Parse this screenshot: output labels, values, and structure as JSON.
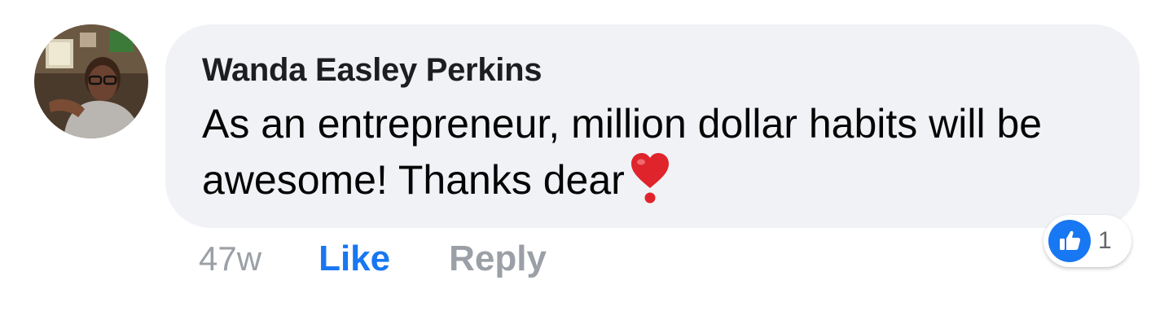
{
  "comment": {
    "author": "Wanda Easley Perkins",
    "text": "As an entrepreneur, million dollar habits will be awesome! Thanks dear",
    "emoji": "heavy-heart-exclamation",
    "timestamp": "47w",
    "like_label": "Like",
    "reply_label": "Reply",
    "reaction_count": "1",
    "reaction_type": "like-icon"
  },
  "colors": {
    "bubble_bg": "#f0f2f5",
    "accent_blue": "#1877f2",
    "muted_text": "#9ba0a7",
    "emoji_red": "#e0242c"
  }
}
